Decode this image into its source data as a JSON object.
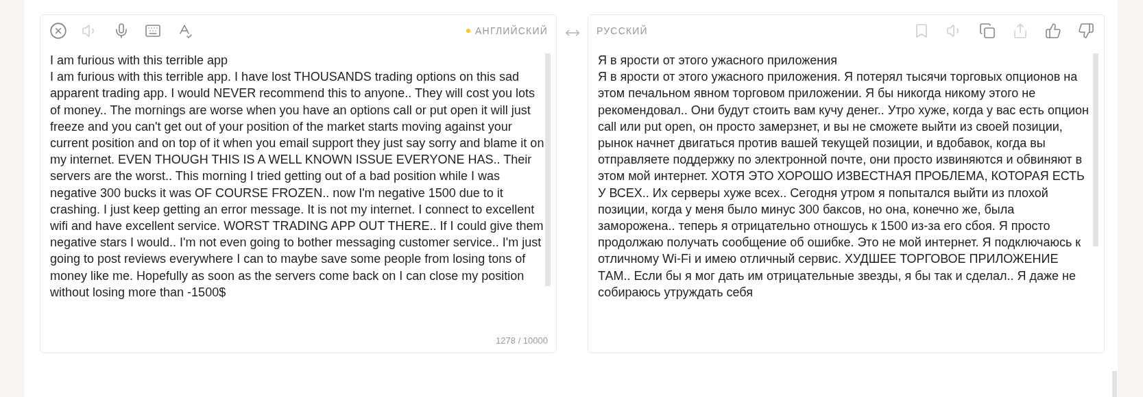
{
  "source": {
    "tools": [
      {
        "kind": "clear",
        "disabled": false
      },
      {
        "kind": "listen",
        "disabled": true
      },
      {
        "kind": "voice",
        "disabled": false
      },
      {
        "kind": "keyboard",
        "disabled": false
      },
      {
        "kind": "spellcheck",
        "disabled": false
      }
    ],
    "language": "АНГЛИЙСКИЙ",
    "detected": true,
    "paragraphs": [
      "I am furious with this terrible app",
      "I am furious with this terrible app. I have lost THOUSANDS trading options on this sad apparent trading app. I would NEVER recommend this to anyone.. They will cost you lots of money.. The mornings are worse when you have an options call or put open it will just freeze and you can't get out of your position of the market starts moving against your current position and on top of it when you email support they just say sorry and blame it on my internet. EVEN THOUGH THIS IS A WELL KNOWN ISSUE EVERYONE HAS.. Their servers are the worst.. This morning I tried getting out of a bad position while I was negative 300 bucks it was OF COURSE FROZEN.. now I'm negative 1500 due to it crashing. I just keep getting an error message. It is not my internet. I connect to excellent wifi and have excellent service. WORST TRADING APP OUT THERE.. If I could give them negative stars I would.. I'm not even going to bother messaging customer service.. I'm just going to post reviews everywhere I can to maybe save some people from losing tons of money like me. Hopefully as soon as the servers come back on I can close my position without losing more than -1500$"
    ],
    "counter": "1278 / 10000"
  },
  "target": {
    "language": "РУССКИЙ",
    "tools": [
      {
        "kind": "bookmark",
        "disabled": true
      },
      {
        "kind": "listen",
        "disabled": true
      },
      {
        "kind": "copy",
        "disabled": false
      },
      {
        "kind": "share",
        "disabled": true
      },
      {
        "kind": "like",
        "disabled": false
      },
      {
        "kind": "dislike",
        "disabled": false
      }
    ],
    "paragraphs": [
      "Я в ярости от этого ужасного приложения",
      "Я в ярости от этого ужасного приложения. Я потерял тысячи торговых опционов на этом печальном явном торговом приложении. Я бы никогда никому этого не рекомендовал.. Они будут стоить вам кучу денег.. Утро хуже, когда у вас есть опцион call или put open, он просто замерзнет, и вы не сможете выйти из своей позиции, рынок начнет двигаться против вашей текущей позиции, и вдобавок, когда вы отправляете поддержку по электронной почте, они просто извиняются и обвиняют в этом мой интернет. ХОТЯ ЭТО ХОРОШО ИЗВЕСТНАЯ ПРОБЛЕМА, КОТОРАЯ ЕСТЬ У ВСЕХ.. Их серверы хуже всех.. Сегодня утром я попытался выйти из плохой позиции, когда у меня было минус 300 баксов, но она, конечно же, была заморожена.. теперь я отрицательно отношусь к 1500 из-за его сбоя. Я просто продолжаю получать сообщение об ошибке. Это не мой интернет. Я подключаюсь к отличному Wi-Fi и имею отличный сервис. ХУДШЕЕ ТОРГОВОЕ ПРИЛОЖЕНИЕ ТАМ.. Если бы я мог дать им отрицательные звезды, я бы так и сделал.. Я даже не собираюсь утруждать себя"
    ]
  }
}
